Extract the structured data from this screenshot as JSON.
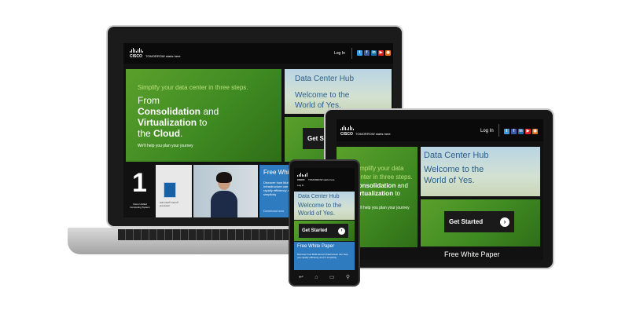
{
  "brand": {
    "logo": "CISCO",
    "tagline": "TOMORROW starts here"
  },
  "nav": {
    "login": "Log In"
  },
  "social_icons": [
    "twitter-icon",
    "facebook-icon",
    "linkedin-icon",
    "youtube-icon",
    "rss-icon"
  ],
  "hero": {
    "eyebrow": "Simplify your data center in three steps.",
    "line1": "From",
    "line2_bold": "Consolidation",
    "line2_rest": " and",
    "line3_bold": "Virtualization",
    "line3_rest": " to",
    "line4": "the",
    "line4_bold": "Cloud",
    "line4_end": ".",
    "sub": "We'll help you plan your journey"
  },
  "hub": {
    "title": "Data Center Hub",
    "welcome1": "Welcome to the",
    "welcome2": "World of Yes."
  },
  "cta": {
    "label": "Get Started"
  },
  "promo": {
    "number": "1",
    "ucs": "Cisco Unified Computing System",
    "intel": "with Intel® Xeon® processor",
    "white_paper": "Free White Paper",
    "wp_desc": "Discover how Multi-tiered Infrastructure can help you rapidly efficiency and IT simplicity",
    "download": "Download now"
  },
  "colors": {
    "green": "#4a9428",
    "dark": "#0a0a0a",
    "blue": "#2f7bbf"
  }
}
